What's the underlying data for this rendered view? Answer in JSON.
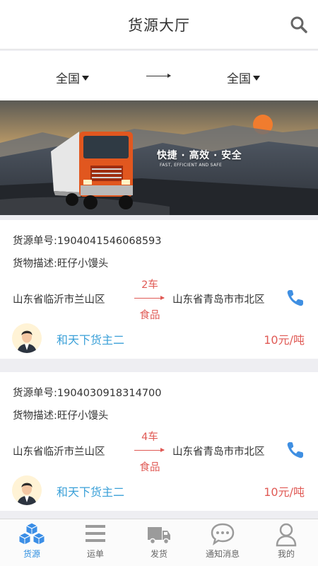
{
  "header": {
    "title": "货源大厅",
    "search_icon": "search-icon"
  },
  "route": {
    "from": "全国",
    "to": "全国"
  },
  "banner": {
    "slogan": "快捷 · 高效 · 安全",
    "slogan_en": "FAST, EFFICIENT AND SAFE"
  },
  "cards": [
    {
      "order_no": "货源单号:1904041546068593",
      "description": "货物描述:旺仔小馒头",
      "origin": "山东省临沂市兰山区",
      "cars": "2车",
      "goods": "食品",
      "destination": "山东省青岛市市北区",
      "owner": "和天下货主二",
      "price": "10元/吨"
    },
    {
      "order_no": "货源单号:1904030918314700",
      "description": "货物描述:旺仔小馒头",
      "origin": "山东省临沂市兰山区",
      "cars": "4车",
      "goods": "食品",
      "destination": "山东省青岛市市北区",
      "owner": "和天下货主二",
      "price": "10元/吨"
    }
  ],
  "tabs": [
    {
      "label": "货源",
      "icon": "cubes-icon",
      "active": true
    },
    {
      "label": "运单",
      "icon": "list-icon",
      "active": false
    },
    {
      "label": "发货",
      "icon": "truck-icon",
      "active": false
    },
    {
      "label": "通知消息",
      "icon": "chat-icon",
      "active": false
    },
    {
      "label": "我的",
      "icon": "user-icon",
      "active": false
    }
  ],
  "colors": {
    "accent": "#2f8fe0",
    "price_red": "#e05a55",
    "owner_blue": "#3aa0d8"
  }
}
